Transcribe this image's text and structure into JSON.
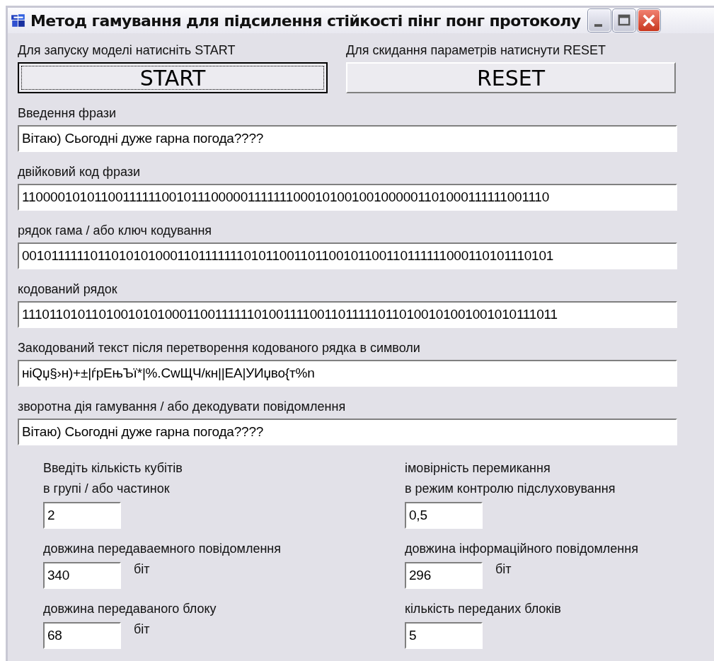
{
  "window": {
    "title": "Метод гамування для підсилення стійкості пінг понг протоколу"
  },
  "actions": [
    {
      "label": "Для запуску моделі натисніть START",
      "button": "START",
      "focused": true
    },
    {
      "label": "Для скидання параметрів натиснути RESET",
      "button": "RESET",
      "focused": false
    }
  ],
  "fields": [
    {
      "label": "Введення фрази",
      "value": "Вітаю) Сьогодні дуже гарна погода????"
    },
    {
      "label": "двійковий код фрази",
      "value": "110000101011001111110010111000001111111000101001001000001101000111111001110"
    },
    {
      "label": "рядок гама / або ключ кодування",
      "value": "0010111111011010101000110111111101011001101100101100110111111000110101110101"
    },
    {
      "label": "кодований рядок",
      "value": "1110110101101001010100011001111110100111100110111110110100101001001010111011"
    },
    {
      "label": "Закодований текст після перетворення кодованого рядка в символи",
      "value": "ніQџ§›н)+±|ѓрЕњЪї*|%.СwЩЧ/кн||ЕА|УИџво{т%n"
    },
    {
      "label": "зворотна дія гамування / або декодувати повідомлення",
      "value": "Вітаю) Сьогодні дуже гарна погода????"
    }
  ],
  "params": [
    {
      "label": [
        "Введіть кількість кубітів",
        "в групі / або частинок"
      ],
      "value": "2"
    },
    {
      "label": [
        "імовірність перемикання",
        "в режим контролю підслуховування"
      ],
      "value": "0,5"
    },
    {
      "label": [
        "довжина передаваемного повідомлення"
      ],
      "value": "340",
      "unit": "біт"
    },
    {
      "label": [
        "довжина інформаційного повідомлення"
      ],
      "value": "296",
      "unit": "біт"
    },
    {
      "label": [
        "довжина передаваного блоку"
      ],
      "value": "68",
      "unit": "біт"
    },
    {
      "label": [
        "кількість переданих блоків"
      ],
      "value": "5"
    }
  ]
}
